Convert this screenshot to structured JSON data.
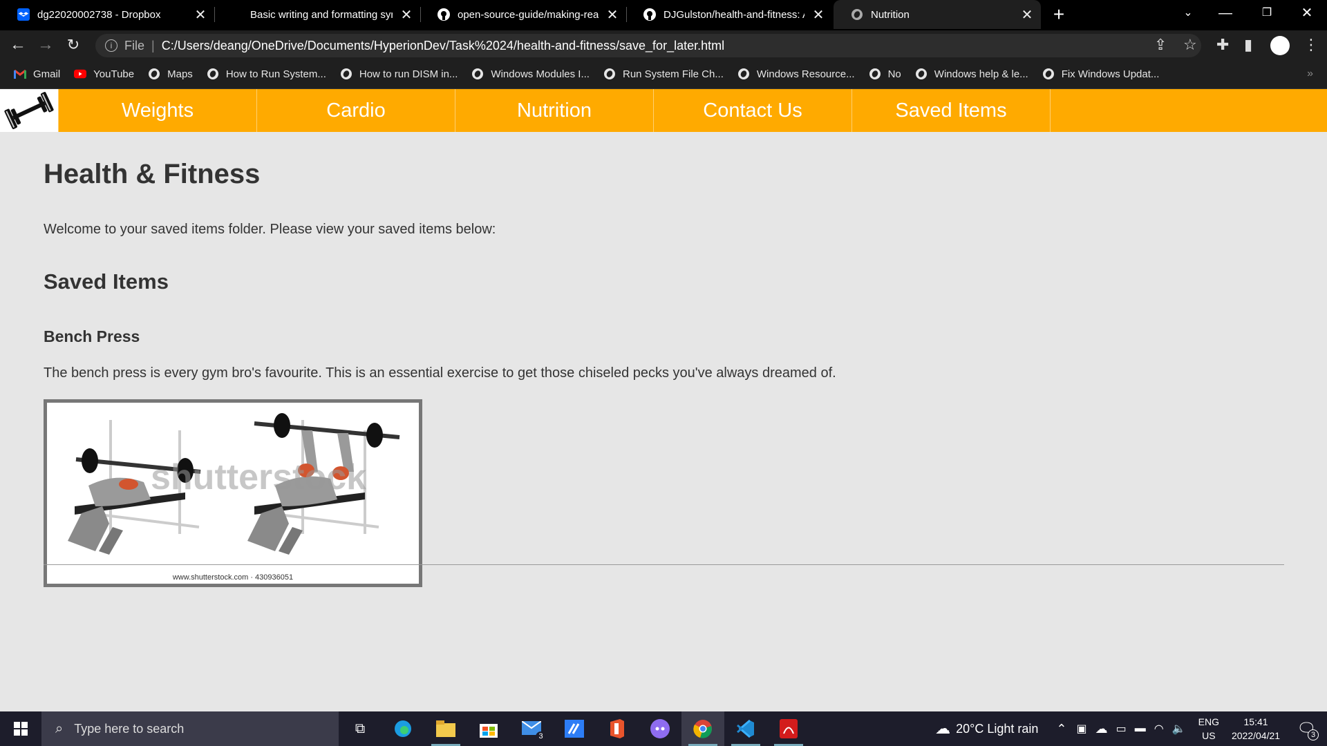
{
  "browser": {
    "tabs": [
      {
        "title": "dg22020002738 - Dropbox",
        "icon": "dropbox-icon",
        "active": false
      },
      {
        "title": "Basic writing and formatting synt",
        "icon": "none",
        "active": false
      },
      {
        "title": "open-source-guide/making-read",
        "icon": "github-icon",
        "active": false
      },
      {
        "title": "DJGulston/health-and-fitness: A",
        "icon": "github-icon",
        "active": false
      },
      {
        "title": "Nutrition",
        "icon": "globe-icon",
        "active": true
      }
    ],
    "file_label": "File",
    "url": "C:/Users/deang/OneDrive/Documents/HyperionDev/Task%2024/health-and-fitness/save_for_later.html",
    "bookmarks": [
      {
        "label": "Gmail",
        "icon": "gmail-icon"
      },
      {
        "label": "YouTube",
        "icon": "youtube-icon"
      },
      {
        "label": "Maps",
        "icon": "globe-icon"
      },
      {
        "label": "How to Run System...",
        "icon": "globe-icon"
      },
      {
        "label": "How to run DISM in...",
        "icon": "globe-icon"
      },
      {
        "label": "Windows Modules I...",
        "icon": "globe-icon"
      },
      {
        "label": "Run System File Ch...",
        "icon": "globe-icon"
      },
      {
        "label": "Windows Resource...",
        "icon": "globe-icon"
      },
      {
        "label": "No",
        "icon": "globe-icon"
      },
      {
        "label": "Windows help & le...",
        "icon": "globe-icon"
      },
      {
        "label": "Fix Windows Updat...",
        "icon": "globe-icon"
      }
    ],
    "bookmarks_more": "»"
  },
  "site": {
    "nav": [
      "Weights",
      "Cardio",
      "Nutrition",
      "Contact Us",
      "Saved Items"
    ],
    "page_title": "Health & Fitness",
    "welcome": "Welcome to your saved items folder. Please view your saved items below:",
    "section_title": "Saved Items",
    "item": {
      "title": "Bench Press",
      "description": "The bench press is every gym bro's favourite. This is an essential exercise to get those chiseled pecks you've always dreamed of.",
      "image_credit": "www.shutterstock.com · 430936051",
      "image_watermark": "shutterstock"
    }
  },
  "taskbar": {
    "search_placeholder": "Type here to search",
    "weather": "20°C  Light rain",
    "lang_top": "ENG",
    "lang_bottom": "US",
    "time": "15:41",
    "date": "2022/04/21",
    "mail_badge": "3",
    "notif_badge": "3"
  }
}
